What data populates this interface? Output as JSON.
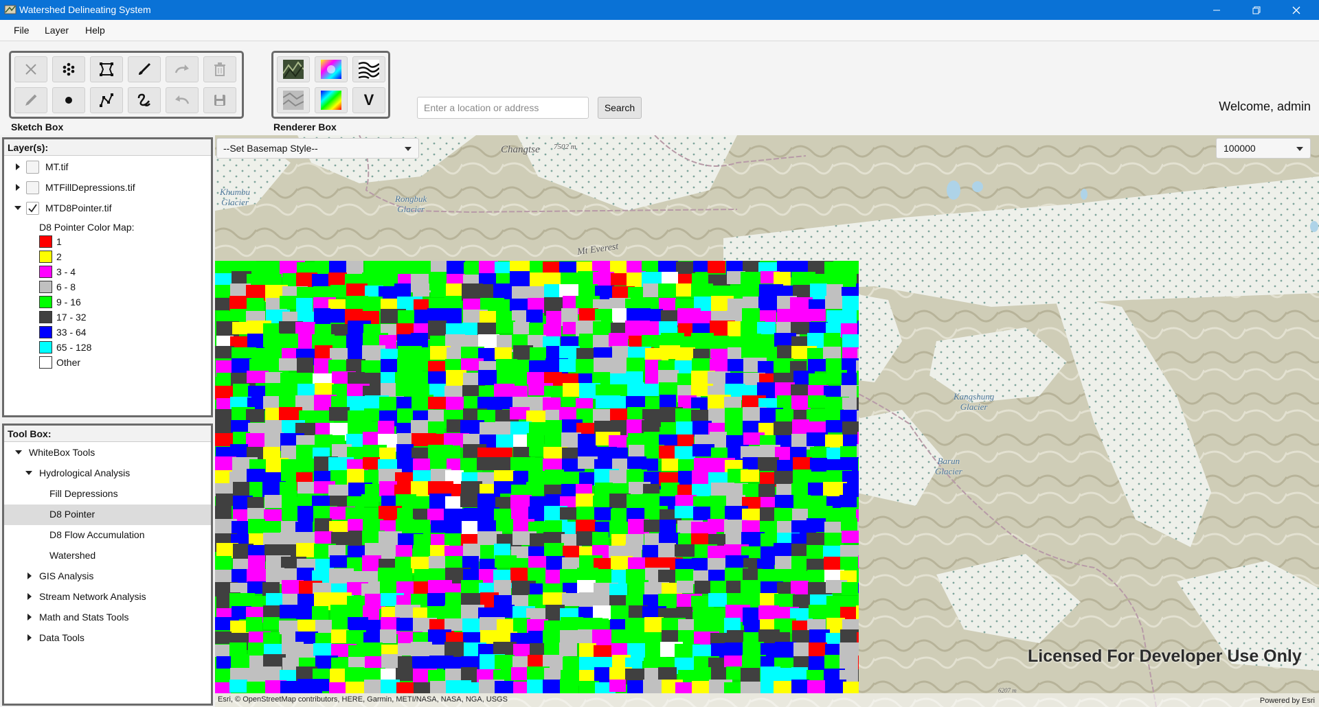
{
  "window": {
    "title": "Watershed Delineating System"
  },
  "menu": [
    "File",
    "Layer",
    "Help"
  ],
  "sketch_box": {
    "label": "Sketch Box",
    "tools": [
      "close-sketch",
      "multipoint",
      "polygon",
      "freehand-line",
      "redo",
      "delete",
      "edit",
      "point",
      "polyline",
      "freehand",
      "undo",
      "save"
    ]
  },
  "renderer_box": {
    "label": "Renderer Box",
    "tools": [
      "hillshade-renderer",
      "rgb-renderer",
      "contour-renderer",
      "slope-renderer",
      "stretch-renderer",
      "vector-renderer"
    ],
    "v_label": "V"
  },
  "search": {
    "placeholder": "Enter a location or address",
    "button": "Search"
  },
  "welcome": "Welcome, admin",
  "layers": {
    "header": "Layer(s):",
    "items": [
      {
        "name": "MT.tif",
        "checked": false,
        "expanded": false
      },
      {
        "name": "MTFillDepressions.tif",
        "checked": false,
        "expanded": false
      },
      {
        "name": "MTD8Pointer.tif",
        "checked": true,
        "expanded": true
      }
    ],
    "legend_title": "D8 Pointer Color Map:",
    "legend": [
      {
        "label": "1",
        "color": "#ff0000"
      },
      {
        "label": "2",
        "color": "#ffff00"
      },
      {
        "label": "3 - 4",
        "color": "#ff00ff"
      },
      {
        "label": "6 - 8",
        "color": "#c0c0c0"
      },
      {
        "label": "9 - 16",
        "color": "#00ff00"
      },
      {
        "label": "17 - 32",
        "color": "#404040"
      },
      {
        "label": "33 - 64",
        "color": "#0000ff"
      },
      {
        "label": "65 - 128",
        "color": "#00ffff"
      },
      {
        "label": "Other",
        "color": "#ffffff"
      }
    ]
  },
  "toolbox": {
    "header": "Tool Box:",
    "root": "WhiteBox Tools",
    "hydro": "Hydrological Analysis",
    "hydro_tools": [
      "Fill Depressions",
      "D8 Pointer",
      "D8 Flow Accumulation",
      "Watershed"
    ],
    "selected": "D8 Pointer",
    "groups": [
      "GIS Analysis",
      "Stream Network Analysis",
      "Math and Stats Tools",
      "Data Tools"
    ]
  },
  "map": {
    "basemap_select": "--Set Basemap Style--",
    "scale_select": "100000",
    "labels": {
      "changtse": "Changtse",
      "changtse_elev": "7502 m",
      "khumbu": "Khumbu\nGlacier",
      "rongbuk": "Rongbuk\nGlacier",
      "everest": "Mt Everest",
      "kangshung": "Kangshung\nGlacier",
      "barun": "Barun\nGlacier",
      "bottom_elev": "6207 m"
    },
    "watermark": "Licensed For Developer Use Only",
    "attribution": "Esri, © OpenStreetMap contributors, HERE, Garmin, METI/NASA, NASA, NGA, USGS",
    "powered_by": "Powered by Esri"
  }
}
